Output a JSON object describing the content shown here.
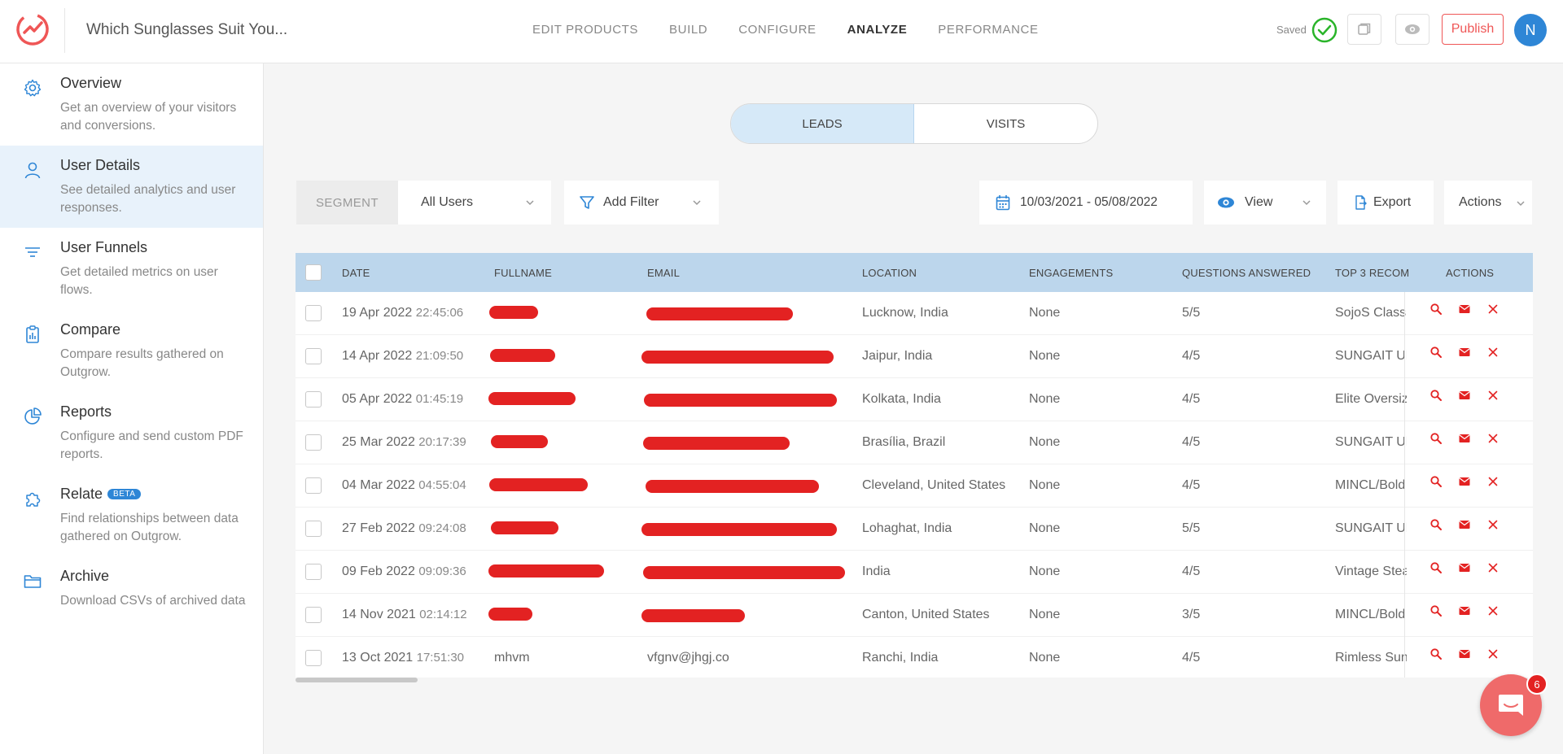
{
  "app": {
    "title": "Which Sunglasses Suit You..."
  },
  "nav": [
    {
      "label": "EDIT PRODUCTS"
    },
    {
      "label": "BUILD"
    },
    {
      "label": "CONFIGURE"
    },
    {
      "label": "ANALYZE",
      "active": true
    },
    {
      "label": "PERFORMANCE"
    }
  ],
  "header": {
    "saved_label": "Saved",
    "publish_label": "Publish",
    "avatar_initial": "N"
  },
  "sidebar": {
    "items": [
      {
        "title": "Overview",
        "desc": "Get an overview of your visitors and conversions.",
        "icon": "gear-icon"
      },
      {
        "title": "User Details",
        "desc": "See detailed analytics and user responses.",
        "icon": "user-icon",
        "active": true
      },
      {
        "title": "User Funnels",
        "desc": "Get detailed metrics on user flows.",
        "icon": "funnel-lines-icon"
      },
      {
        "title": "Compare",
        "desc": "Compare results gathered on Outgrow.",
        "icon": "clipboard-chart-icon"
      },
      {
        "title": "Reports",
        "desc": "Configure and send custom PDF reports.",
        "icon": "pie-chart-icon"
      },
      {
        "title": "Relate",
        "badge": "BETA",
        "desc": "Find relationships between data gathered on Outgrow.",
        "icon": "puzzle-icon"
      },
      {
        "title": "Archive",
        "desc": "Download CSVs of archived data",
        "icon": "folder-icon"
      }
    ]
  },
  "toggle": {
    "leads": "LEADS",
    "visits": "VISITS",
    "active": "leads"
  },
  "filters": {
    "segment_label": "SEGMENT",
    "segment_value": "All Users",
    "add_filter": "Add Filter",
    "date_range": "10/03/2021 - 05/08/2022",
    "view": "View",
    "export": "Export",
    "actions": "Actions"
  },
  "table": {
    "columns": [
      "DATE",
      "FULLNAME",
      "EMAIL",
      "LOCATION",
      "ENGAGEMENTS",
      "QUESTIONS ANSWERED",
      "TOP 3 RECOM",
      "ACTIONS"
    ],
    "rows": [
      {
        "date": "19 Apr 2022",
        "time": "22:45:06",
        "fullname": "",
        "email": "",
        "location": "Lucknow, India",
        "engagements": "None",
        "questions": "5/5",
        "top3": "SojoS Classic"
      },
      {
        "date": "14 Apr 2022",
        "time": "21:09:50",
        "fullname": "",
        "email": "",
        "location": "Jaipur, India",
        "engagements": "None",
        "questions": "4/5",
        "top3": "SUNGAIT Ultra"
      },
      {
        "date": "05 Apr 2022",
        "time": "01:45:19",
        "fullname": "",
        "email": "",
        "location": "Kolkata, India",
        "engagements": "None",
        "questions": "4/5",
        "top3": "Elite Oversized"
      },
      {
        "date": "25 Mar 2022",
        "time": "20:17:39",
        "fullname": "",
        "email": "",
        "location": "Brasília, Brazil",
        "engagements": "None",
        "questions": "4/5",
        "top3": "SUNGAIT Ultra"
      },
      {
        "date": "04 Mar 2022",
        "time": "04:55:04",
        "fullname": "",
        "email": "",
        "location": "Cleveland, United States",
        "engagements": "None",
        "questions": "4/5",
        "top3": "MINCL/Bold"
      },
      {
        "date": "27 Feb 2022",
        "time": "09:24:08",
        "fullname": "",
        "email": "",
        "location": "Lohaghat, India",
        "engagements": "None",
        "questions": "5/5",
        "top3": "SUNGAIT Ultra"
      },
      {
        "date": "09 Feb 2022",
        "time": "09:09:36",
        "fullname": "",
        "email": "",
        "location": "India",
        "engagements": "None",
        "questions": "4/5",
        "top3": "Vintage Steam"
      },
      {
        "date": "14 Nov 2021",
        "time": "02:14:12",
        "fullname": "",
        "email": "",
        "location": "Canton, United States",
        "engagements": "None",
        "questions": "3/5",
        "top3": "MINCL/Bold"
      },
      {
        "date": "13 Oct 2021",
        "time": "17:51:30",
        "fullname": "mhvm",
        "email": "vfgnv@jhgj.co",
        "location": "Ranchi, India",
        "engagements": "None",
        "questions": "4/5",
        "top3": "Rimless Sun"
      }
    ]
  },
  "chat": {
    "badge_count": "6"
  },
  "colors": {
    "accent": "#2e86d6",
    "brand_red": "#ef5656",
    "header_row": "#bcd6ec",
    "active_side": "#e8f2fb",
    "redaction": "#e32222"
  }
}
